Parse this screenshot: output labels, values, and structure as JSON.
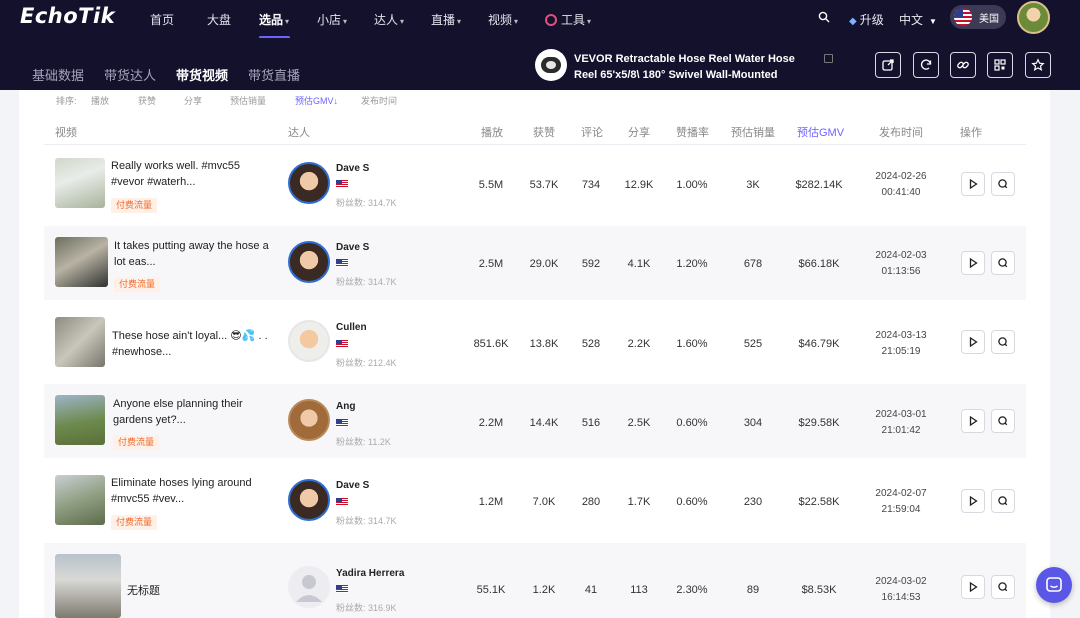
{
  "brand": {
    "logo": "EchoTik"
  },
  "topnav": {
    "items": [
      "首页",
      "大盘",
      "选品",
      "小店",
      "达人",
      "直播",
      "视频",
      "工具"
    ],
    "upgrade": "升级",
    "language": "中文",
    "region": "美国"
  },
  "subnav": {
    "tabs": [
      "基础数据",
      "带货达人",
      "带货视频",
      "带货直播"
    ],
    "active_tab": "带货视频"
  },
  "product": {
    "title": "VEVOR Retractable Hose Reel Water Hose Reel 65'x5/8\\ 180° Swivel Wall-Mounted"
  },
  "sort": {
    "label": "排序:",
    "options": [
      "播放",
      "获赞",
      "分享",
      "预估销量",
      "预估GMV↓",
      "发布时间"
    ]
  },
  "table": {
    "headers": [
      "视频",
      "达人",
      "播放",
      "获赞",
      "评论",
      "分享",
      "赞播率",
      "预估销量",
      "预估GMV",
      "发布时间",
      "操作"
    ],
    "rows": [
      {
        "title": "Really works well. #mvc55 #vevor #waterh...",
        "tag": "付费流量",
        "creator": "Dave S",
        "fans": "粉丝数: 314.7K",
        "plays": "5.5M",
        "likes": "53.7K",
        "comments": "734",
        "shares": "12.9K",
        "rate": "1.00%",
        "sales": "3K",
        "gmv": "$282.14K",
        "date": "2024-02-26",
        "time": "00:41:40"
      },
      {
        "title": "It takes putting away the hose a lot eas...",
        "tag": "付费流量",
        "creator": "Dave S",
        "fans": "粉丝数: 314.7K",
        "plays": "2.5M",
        "likes": "29.0K",
        "comments": "592",
        "shares": "4.1K",
        "rate": "1.20%",
        "sales": "678",
        "gmv": "$66.18K",
        "date": "2024-02-03",
        "time": "01:13:56"
      },
      {
        "title": "These hose ain't loyal... 😎💦 . . #newhose...",
        "tag": "",
        "creator": "Cullen",
        "fans": "粉丝数: 212.4K",
        "plays": "851.6K",
        "likes": "13.8K",
        "comments": "528",
        "shares": "2.2K",
        "rate": "1.60%",
        "sales": "525",
        "gmv": "$46.79K",
        "date": "2024-03-13",
        "time": "21:05:19"
      },
      {
        "title": "Anyone else planning their gardens yet?...",
        "tag": "付费流量",
        "creator": "Ang",
        "fans": "粉丝数: 11.2K",
        "plays": "2.2M",
        "likes": "14.4K",
        "comments": "516",
        "shares": "2.5K",
        "rate": "0.60%",
        "sales": "304",
        "gmv": "$29.58K",
        "date": "2024-03-01",
        "time": "21:01:42"
      },
      {
        "title": "Eliminate hoses lying around #mvc55 #vev...",
        "tag": "付费流量",
        "creator": "Dave S",
        "fans": "粉丝数: 314.7K",
        "plays": "1.2M",
        "likes": "7.0K",
        "comments": "280",
        "shares": "1.7K",
        "rate": "0.60%",
        "sales": "230",
        "gmv": "$22.58K",
        "date": "2024-02-07",
        "time": "21:59:04"
      },
      {
        "title": "无标题",
        "tag": "",
        "creator": "Yadira Herrera",
        "fans": "粉丝数: 316.9K",
        "plays": "55.1K",
        "likes": "1.2K",
        "comments": "41",
        "shares": "113",
        "rate": "2.30%",
        "sales": "89",
        "gmv": "$8.53K",
        "date": "2024-03-02",
        "time": "16:14:53"
      }
    ]
  },
  "colors": {
    "nav_bg": "#14112d",
    "accent": "#6f63ff",
    "tag": "#f06a2a"
  }
}
